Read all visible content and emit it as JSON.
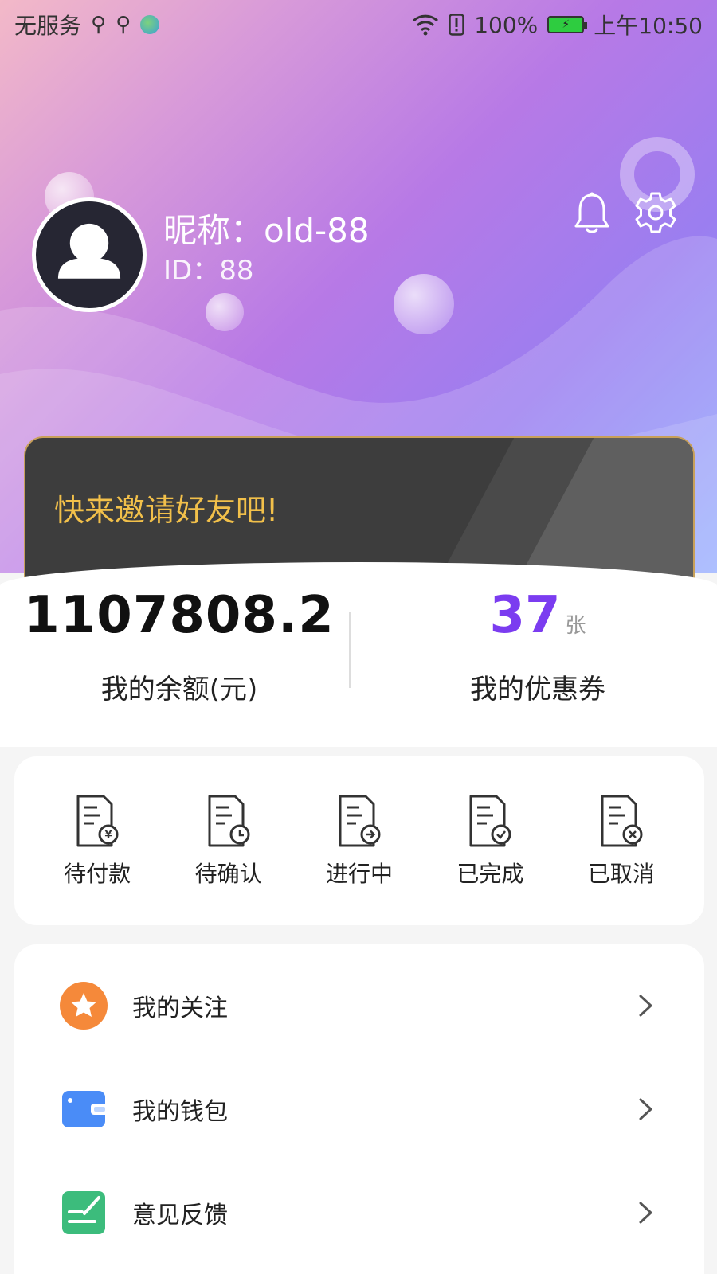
{
  "status_bar": {
    "carrier": "无服务",
    "usb_icon_1": "usb-icon",
    "usb_icon_2": "usb-icon",
    "battery_percent": "100%",
    "time": "上午10:50"
  },
  "profile": {
    "nickname": "昵称：old-88",
    "id": "ID：88"
  },
  "invite_banner": {
    "text": "快来邀请好友吧!"
  },
  "stats": {
    "balance_value": "1107808.2",
    "balance_label": "我的余额(元)",
    "coupon_value": "37",
    "coupon_unit": "张",
    "coupon_label": "我的优惠券"
  },
  "orders": [
    {
      "label": "待付款",
      "icon": "payment-pending-icon"
    },
    {
      "label": "待确认",
      "icon": "confirm-pending-icon"
    },
    {
      "label": "进行中",
      "icon": "in-progress-icon"
    },
    {
      "label": "已完成",
      "icon": "completed-icon"
    },
    {
      "label": "已取消",
      "icon": "cancelled-icon"
    }
  ],
  "menu": [
    {
      "label": "我的关注",
      "icon": "star-icon",
      "color": "#f5893a"
    },
    {
      "label": "我的钱包",
      "icon": "wallet-icon",
      "color": "#4a8cf7"
    },
    {
      "label": "意见反馈",
      "icon": "feedback-icon",
      "color": "#3cbc7c"
    }
  ],
  "colors": {
    "accent_purple": "#7b3cf0",
    "invite_text": "#f2c04a"
  }
}
